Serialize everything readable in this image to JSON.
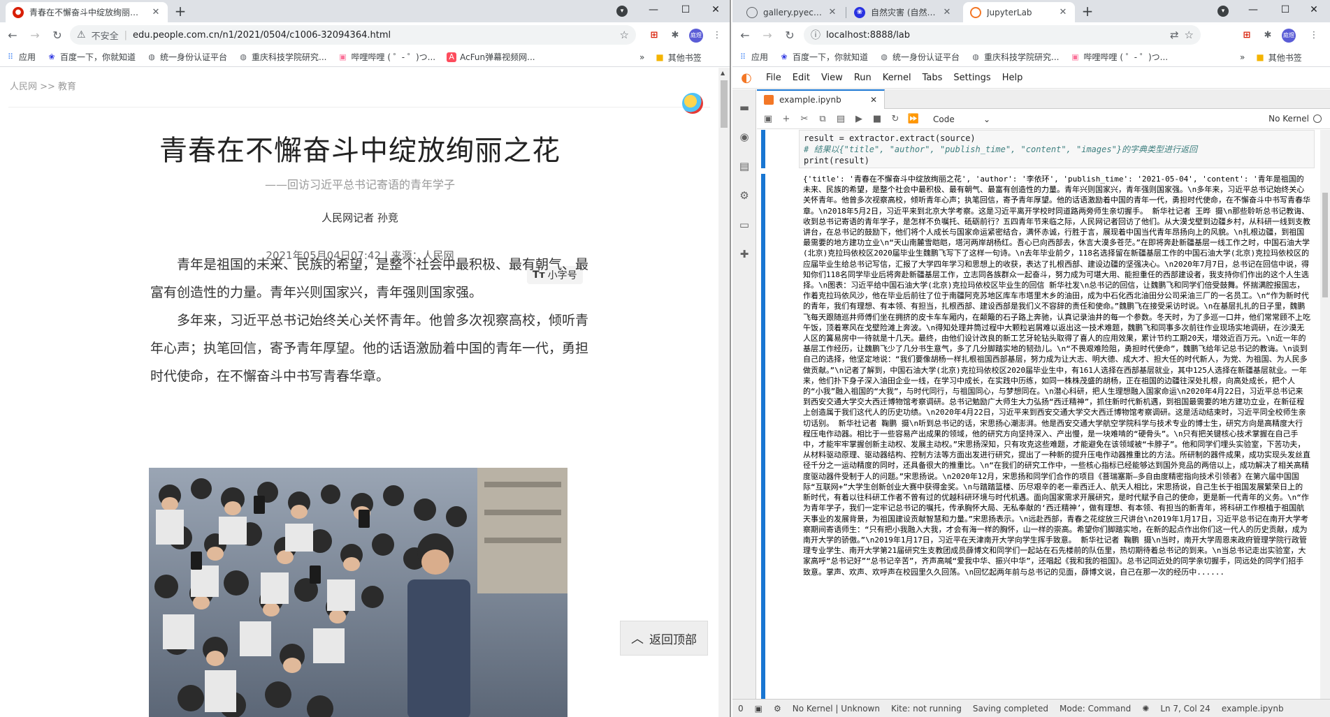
{
  "left_browser": {
    "tabs": [
      {
        "title": "青春在不懈奋斗中绽放绚丽之花-",
        "favicon": "people-daily-icon"
      }
    ],
    "address": {
      "security_label": "不安全",
      "url": "edu.people.com.cn/n1/2021/0504/c1006-32094364.html"
    },
    "bookmarks": [
      {
        "label": "应用",
        "icon": "apps-grid-icon"
      },
      {
        "label": "百度一下，你就知道",
        "icon": "baidu-paw-icon"
      },
      {
        "label": "统一身份认证平台",
        "icon": "globe-icon"
      },
      {
        "label": "重庆科技学院研究...",
        "icon": "globe-icon"
      },
      {
        "label": "哔哩哔哩 ( ゜- ゜)つ...",
        "icon": "bilibili-tv-icon"
      },
      {
        "label": "AcFun弹幕视频网...",
        "icon": "acfun-icon"
      }
    ],
    "bookmarks_more": "»",
    "other_bookmarks": "其他书签",
    "avatar_text": "庭煜"
  },
  "article": {
    "breadcrumb": "人民网 >> 教育",
    "title": "青春在不懈奋斗中绽放绚丽之花",
    "subtitle": "——回访习近平总书记寄语的青年学子",
    "author": "人民网记者 孙竞",
    "meta": "2021年05月04日07:42 | 来源：人民网",
    "font_size_button": "小字号",
    "font_size_glyph": "Tт",
    "paragraphs": [
      "青年是祖国的未来、民族的希望，是整个社会中最积极、最有朝气、最富有创造性的力量。青年兴则国家兴，青年强则国家强。",
      "多年来，习近平总书记始终关心关怀青年。他曾多次视察高校，倾听青年心声；执笔回信，寄予青年厚望。他的话语激励着中国的青年一代，勇担时代使命，在不懈奋斗中书写青春华章。"
    ],
    "back_to_top": "返回顶部"
  },
  "right_browser": {
    "tabs": [
      {
        "title": "gallery.pyecharts.org",
        "favicon": "globe-icon"
      },
      {
        "title": "自然灾害 (自然界中所发",
        "favicon": "baidu-paw-icon"
      },
      {
        "title": "JupyterLab",
        "favicon": "jupyter-icon"
      }
    ],
    "address": {
      "url": "localhost:8888/lab"
    },
    "bookmarks": [
      {
        "label": "应用",
        "icon": "apps-grid-icon"
      },
      {
        "label": "百度一下，你就知道",
        "icon": "baidu-paw-icon"
      },
      {
        "label": "统一身份认证平台",
        "icon": "globe-icon"
      },
      {
        "label": "重庆科技学院研究...",
        "icon": "globe-icon"
      },
      {
        "label": "哔哩哔哩 ( ゜- ゜)つ...",
        "icon": "bilibili-tv-icon"
      }
    ],
    "bookmarks_more": "»",
    "other_bookmarks": "其他书签",
    "avatar_text": "庭煜"
  },
  "jupyter": {
    "menu": [
      "File",
      "Edit",
      "View",
      "Run",
      "Kernel",
      "Tabs",
      "Settings",
      "Help"
    ],
    "tab_title": "example.ipynb",
    "cell_type": "Code",
    "kernel_label": "No Kernel",
    "code_lines": [
      {
        "type": "plain",
        "text": "result = extractor.extract(source)"
      },
      {
        "type": "comment",
        "text": "# 结果以{\"title\", \"author\", \"publish_time\", \"content\", \"images\"}的字典类型进行返回"
      },
      {
        "type": "plain",
        "text": "print(result)"
      }
    ],
    "output": "{'title': '青春在不懈奋斗中绽放绚丽之花', 'author': '李依环', 'publish_time': '2021-05-04', 'content': '青年是祖国的未来、民族的希望，是整个社会中最积极、最有朝气、最富有创造性的力量。青年兴则国家兴，青年强则国家强。\\n多年来，习近平总书记始终关心关怀青年。他曾多次视察高校，倾听青年心声；执笔回信，寄予青年厚望。他的话语激励着中国的青年一代，勇担时代使命，在不懈奋斗中书写青春华章。\\n2018年5月2日，习近平来到北京大学考察。这是习近平离开学校时同道路两旁师生亲切握手。 新华社记者 王晔 摄\\n那些聆听总书记教诲、收到总书记寄语的青年学子，是怎样不负嘱托、砥砺前行？五四青年节来临之际，人民网记者回访了他们。从大漠戈壁到边疆乡村，从科研一线到支教讲台，在总书记的鼓励下，他们将个人成长与国家命运紧密结合，满怀赤诚，行胜于言，展现着中国当代青年昂扬向上的风貌。\\n扎根边疆，到祖国最需要的地方建功立业\\n“天山南麓雪皑皑，塔河两岸胡杨红。吾心已向西部去，休言大漠多苍茫。”在即将奔赴新疆基层一线工作之时，中国石油大学(北京)克拉玛依校区2020届毕业生魏鹏飞写下了这样一句诗。\\n去年毕业前夕，118名选择留在新疆基层工作的中国石油大学(北京)克拉玛依校区的应届毕业生给总书记写信，汇报了大学四年学习和思想上的收获，表达了扎根西部、建设边疆的坚强决心。\\n2020年7月7日，总书记在回信中说，得知你们118名同学毕业后将奔赴新疆基层工作，立志同各族群众一起奋斗，努力成为可堪大用、能担重任的西部建设者，我支持你们作出的这个人生选择。\\n图表：习近平给中国石油大学(北京)克拉玛依校区毕业生的回信 新华社发\\n总书记的回信，让魏鹏飞和同学们倍受鼓舞。怀揣满腔报国志，作着克拉玛依风沙，他在毕业后前往了位于南疆阿克苏地区库车市塔里木乡的油田，成为中石化西北油田分公司采油三厂的一名员工。\\n“作为新时代的青年，我们有理想、有本领、有担当，扎根西部、建设西部是我们义不容辞的责任和使命。”魏鹏飞在接受采访时说。\\n在基层扎扎的日子里，魏鹏飞每天跟随巡井师傅们坐在拥挤的皮卡车车厢内，在颠簸的石子路上奔驰，认真记录油井的每一个参数。冬天时，为了多巡一口井，他们常常顾不上吃午饭，顶着寒风在戈壁险滩上奔波。\\n得知处理井筒过程中大颗粒岩屑难以返出这一技术难题，魏鹏飞和同事多次前往作业现场实地调研，在沙漠无人区的篝易房中一待就是十几天。最终，由他们设计改良的新工艺牙轮钻头取得了喜人的应用效果，累计节约工期20天，增效近百万元。\\n近一年的基层工作经历，让魏鹏飞少了几分书生意气，多了几分脚踏实地的韧劲儿。\\n“不畏艰难险阻，勇担时代使命”，魏鹏飞给年记总书记的教诲。\\n谈到自己的选择，他坚定地说：“我们要像胡杨一样扎根祖国西部基层，努力成为让大志、明大德、成大才、担大任的时代新人，为党、为祖国、为人民多做贡献。”\\n记者了解到，中国石油大学(北京)克拉玛依校区2020届毕业生中，有161人选择在西部基层就业，其中125人选择在新疆基层就业。一年来，他们扑下身子深入油田企业一线，在学习中成长，在实践中历练，如同一株株茂盛的胡杨，正在祖国的边疆往深处扎根，向高处成长，把个人的“小我”融入祖国的“大我”，与时代同行，与祖国同心，与梦想同在。\\n潜心科研，把人生理想融入国家命运\\n2020年4月22日，习近平总书记来到西安交通大学交大西迁博物馆考察调研。总书记勉励广大师生大力弘扬“西迁精神”，抓住新时代新机遇，到祖国最需要的地方建功立业，在新征程上创造属于我们这代人的历史功绩。\\n2020年4月22日，习近平来到西安交通大学交大西迁博物馆考察调研。这是活动结束时，习近平同全校师生亲切话别。 新华社记者 鞠鹏 摄\\n听到总书记的话，宋思扬心潮澎湃。他是西安交通大学航空学院科学与技术专业的博士生，研究方向是高精度大行程压电作动器。相比于一些容易产出成果的领域，他的研究方向坚持深入、产出慢，是一块难啃的“硬骨头”。\\n只有把关键核心技术掌握在自己手中，才能牢牢掌握创新主动权、发展主动权。”宋思扬深知，只有攻克这些难题，才能避免在该领域被“卡脖子”。他和同学们埋头实验室，下苦功夫，从材料驱动原理、驱动器结构、控制方法等方面出发进行研究，提出了一种新的提升压电作动器推重比的方法。所研制的器件成果，成功实现头发丝直径千分之一运动精度的同时，还具备很大的推重比。\\n“在我们的研究工作中，一些核心指标已经能够达到国外竞品的两倍以上，成功解决了相关高精度驱动器件受制于人的问题。”宋思扬说。\\n2020年12月，宋思扬和同学们合作的项目《菩瑞塞斯—多自由度精密指向技术引领者》在第六届中国国际“互联网+”大学生创新创业大赛中获得金奖。\\n与踏踏篮楼、历尽艰辛的老一辈西迁人、航天人相比，宋思扬说，自己生长于祖国发展繁荣日上的新时代，有着以往科研工作者不曾有过的优越科研环境与时代机遇。面向国家需求开展研究，是时代赋予自己的使命，更是新一代青年的义务。\\n“作为青年学子，我们一定牢记总书记的嘱托，传承胸怀大局、无私奉献的‘西迁精神’，做有理想、有本领、有担当的新青年，将科研工作根植于祖国航天事业的发展背景，为祖国建设贡献智慧和力量。”宋思扬表示。\\n远赴西部，青春之花绽放三尺讲台\\n2019年1月17日，习近平总书记在南开大学考察期间寄语师生：“只有把小我融入大我，才会有海一样的胸怀，山一样的崇高。希望你们脚踏实地，在新的起点作出你们这一代人的历史贡献，成为南开大学的骄傲。”\\n2019年1月17日，习近平在天津南开大学向学生挥手致意。 新华社记者 鞠鹏 摄\\n当时，南开大学周恩来政府管理学院行政管理专业学生、南开大学第21届研究生支教团成员薛博文和同学们一起站在石先楼前的队伍里，热切期待着总书记的到来。\\n当总书记走出实验室，大家高呼“总书记好”“总书记辛苦”，齐声高喊“爱我中华、振兴中华”，还唱起《我和我的祖国》。总书记同近处的同学亲切握手，同远处的同学们招手致意。掌声、欢声、欢呼声在校园里久久回荡。\\n回忆起两年前与总书记的见面，薛博文说，自己在那一次的经历中......",
    "status": {
      "zero": "0",
      "kernel": "No Kernel | Unknown",
      "kite": "Kite: not running",
      "saving": "Saving completed",
      "mode": "Mode: Command",
      "cursor": "Ln 7, Col 24",
      "file": "example.ipynb"
    }
  }
}
